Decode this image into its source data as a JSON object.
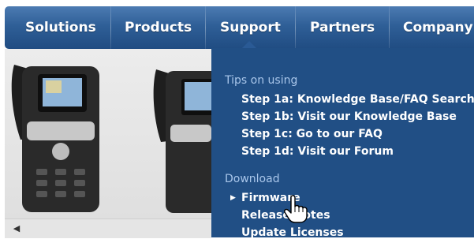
{
  "nav": {
    "items": [
      "Solutions",
      "Products",
      "Support",
      "Partners",
      "Company"
    ]
  },
  "dropdown": {
    "tips_heading": "Tips on using",
    "tips": [
      "Step 1a: Knowledge Base/FAQ Search",
      "Step 1b: Visit our Knowledge Base",
      "Step 1c: Go to our FAQ",
      "Step 1d: Visit our Forum"
    ],
    "download_heading": "Download",
    "downloads": [
      "Firmware",
      "Release Notes",
      "Update Licenses"
    ]
  },
  "icons": {
    "arrow": "triangle-right-icon",
    "scroll": "scroll-left-icon",
    "cursor": "hand-pointer-icon"
  },
  "colors": {
    "nav_background": "#2f5f97",
    "dropdown_background": "#214f85",
    "heading_text": "#a9c6ea"
  }
}
